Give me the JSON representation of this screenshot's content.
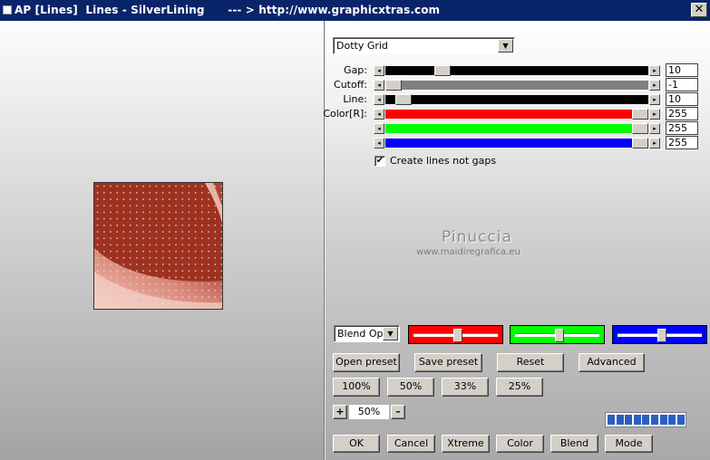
{
  "window": {
    "title": "AP [Lines]  Lines - SilverLining      --- > http://www.graphicxtras.com",
    "close_glyph": "✕"
  },
  "colors": {
    "title_bar": "#0a246a",
    "red": "#ff0000",
    "green": "#00ff00",
    "blue": "#0000ff"
  },
  "effect_dropdown": {
    "value": "Dotty Grid"
  },
  "sliders": [
    {
      "label": "Gap:",
      "value": "10",
      "fill_color": "#000000",
      "fill_fraction": 1.0,
      "thumb_fraction": 0.2
    },
    {
      "label": "Cutoff:",
      "value": "-1",
      "fill_color": "#808080",
      "fill_fraction": 1.0,
      "thumb_fraction": 0.0
    },
    {
      "label": "Line:",
      "value": "10",
      "fill_color": "#000000",
      "fill_fraction": 1.0,
      "thumb_fraction": 0.04
    },
    {
      "label": "Color[R]:",
      "value": "255",
      "fill_color": "#ff0000",
      "fill_fraction": 0.95,
      "thumb_fraction": 1.0
    },
    {
      "label": "",
      "value": "255",
      "fill_color": "#00ff00",
      "fill_fraction": 0.95,
      "thumb_fraction": 1.0
    },
    {
      "label": "",
      "value": "255",
      "fill_color": "#0000ff",
      "fill_fraction": 0.95,
      "thumb_fraction": 1.0
    }
  ],
  "create_lines_checkbox": {
    "label": "Create lines not gaps",
    "checked": true,
    "check_glyph": "✔"
  },
  "watermark": {
    "name": "Pinuccia",
    "url": "www.maidiregrafica.eu"
  },
  "blend_dropdown": {
    "value": "Blend Optio"
  },
  "color_bars": [
    {
      "name": "red",
      "color": "#ff0000",
      "level": 0.5
    },
    {
      "name": "green",
      "color": "#00ff00",
      "level": 0.5
    },
    {
      "name": "blue",
      "color": "#0000ff",
      "level": 0.5
    }
  ],
  "preset_buttons": {
    "open": "Open preset",
    "save": "Save preset",
    "reset": "Reset",
    "advanced": "Advanced"
  },
  "zoom_buttons": [
    "100%",
    "50%",
    "33%",
    "25%"
  ],
  "zoom": {
    "plus": "+",
    "value": "50%",
    "minus": "–"
  },
  "progress": {
    "segments": 9
  },
  "bottom_buttons": {
    "ok": "OK",
    "cancel": "Cancel",
    "xtreme": "Xtreme",
    "color": "Color",
    "blend": "Blend",
    "mode": "Mode"
  }
}
